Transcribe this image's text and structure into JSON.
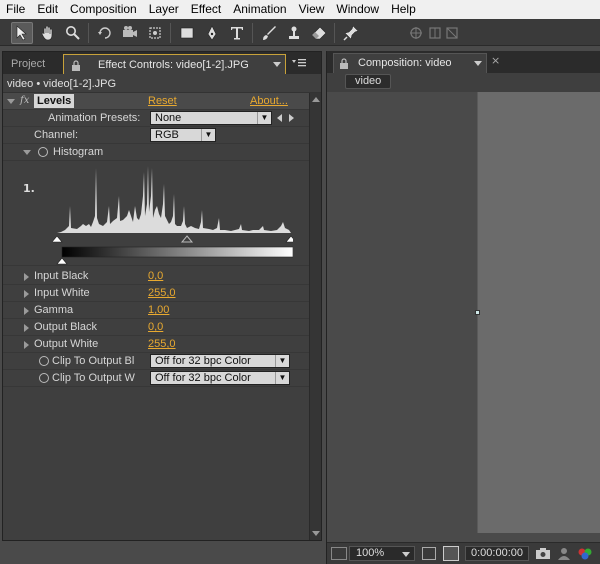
{
  "menu": [
    "File",
    "Edit",
    "Composition",
    "Layer",
    "Effect",
    "Animation",
    "View",
    "Window",
    "Help"
  ],
  "left_panel": {
    "tab_project": "Project",
    "tab_effect_controls": "Effect Controls: video[1-2].JPG",
    "header": "video • video[1-2].JPG",
    "effect": {
      "fx": "fx",
      "name": "Levels",
      "reset": "Reset",
      "about": "About...",
      "presets_label": "Animation Presets:",
      "presets_value": "None",
      "channel_label": "Channel:",
      "channel_value": "RGB",
      "histogram_label": "Histogram",
      "histogram_marker": "1.",
      "params": [
        {
          "label": "Input Black",
          "value": "0,0"
        },
        {
          "label": "Input White",
          "value": "255,0"
        },
        {
          "label": "Gamma",
          "value": "1,00"
        },
        {
          "label": "Output Black",
          "value": "0,0"
        },
        {
          "label": "Output White",
          "value": "255,0"
        }
      ],
      "clip_black_label": "Clip To Output Bl",
      "clip_black_value": "Off for 32 bpc Color",
      "clip_white_label": "Clip To Output W",
      "clip_white_value": "Off for 32 bpc Color"
    }
  },
  "right_panel": {
    "tab_comp": "Composition: video",
    "comp_chip": "video",
    "zoom": "100%",
    "timecode": "0:00:00:00"
  },
  "colors": {
    "accent": "#e8a930",
    "panel": "#3f3f3f",
    "bg": "#4a4a4a",
    "menubar": "#f0f0f0"
  }
}
